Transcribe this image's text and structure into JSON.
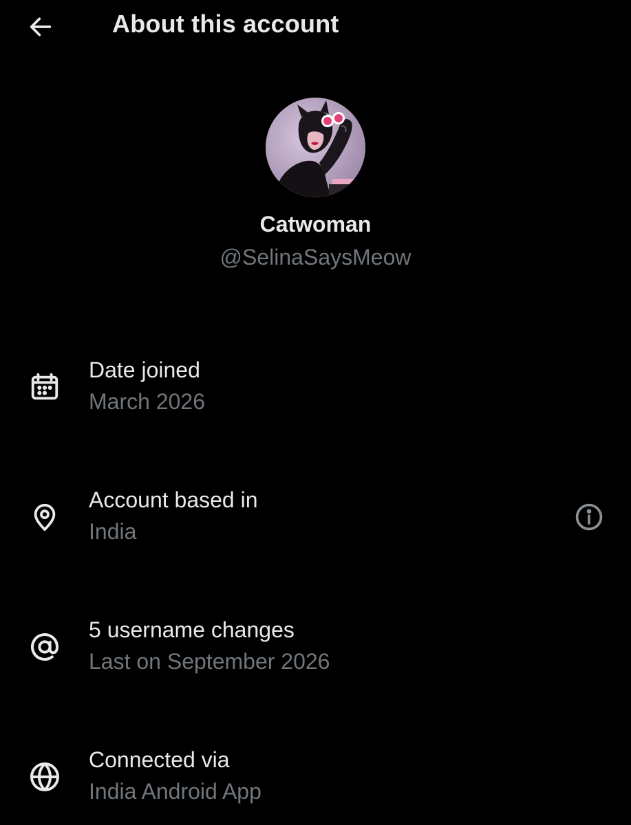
{
  "header": {
    "title": "About this account",
    "back_icon": "arrow-left-icon"
  },
  "profile": {
    "display_name": "Catwoman",
    "handle": "@SelinaSaysMeow"
  },
  "details": {
    "date_joined": {
      "icon": "calendar-icon",
      "title": "Date joined",
      "value": "March 2026"
    },
    "based_in": {
      "icon": "location-pin-icon",
      "title": "Account based in",
      "value": "India",
      "info_icon": "info-icon"
    },
    "username_changes": {
      "icon": "at-sign-icon",
      "title": "5 username changes",
      "value": "Last on September 2026"
    },
    "connected_via": {
      "icon": "globe-icon",
      "title": "Connected via",
      "value": "India Android App"
    }
  },
  "colors": {
    "background": "#000000",
    "primary_text": "#e7e9ea",
    "secondary_text": "#71767b"
  }
}
